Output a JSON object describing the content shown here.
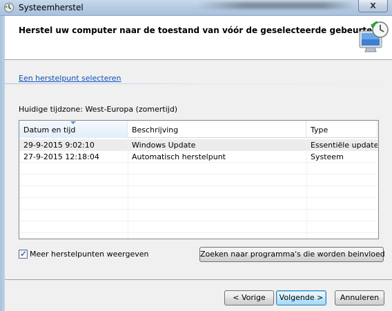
{
  "window": {
    "title": "Systeemherstel",
    "close_label": "X"
  },
  "header": {
    "title": "Herstel uw computer naar de toestand van vóór de geselecteerde gebeurtenis",
    "icon": "system-restore-monitor-icon"
  },
  "link": {
    "label": "Een herstelpunt selecteren"
  },
  "timezone": {
    "label": "Huidige tijdzone: West-Europa (zomertijd)"
  },
  "list": {
    "columns": [
      "Datum en tijd",
      "Beschrijving",
      "Type"
    ],
    "sorted_column": "Datum en tijd",
    "rows": [
      {
        "date": "29-9-2015 9:02:10",
        "description": "Windows Update",
        "type": "Essentiële update",
        "selected": true
      },
      {
        "date": "27-9-2015 12:18:04",
        "description": "Automatisch herstelpunt",
        "type": "Systeem",
        "selected": false
      }
    ]
  },
  "checkbox": {
    "label": "Meer herstelpunten weergeven",
    "checked": true
  },
  "buttons": {
    "scan": "Zoeken naar programma's die worden beinvloed",
    "back": "< Vorige",
    "next": "Volgende >",
    "cancel": "Annuleren"
  },
  "colors": {
    "link": "#0a4fb8",
    "selected_row": "#ececec",
    "default_button_border": "#3c7fb1"
  }
}
